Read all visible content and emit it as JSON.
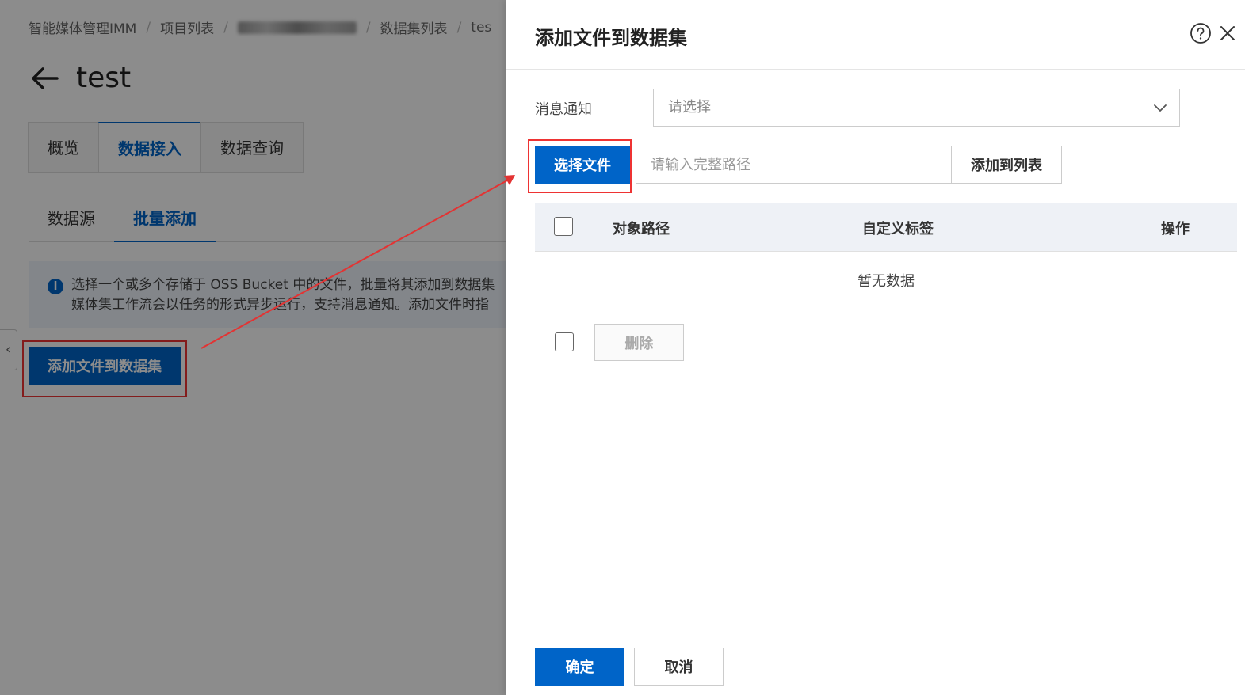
{
  "breadcrumb": {
    "items": [
      "智能媒体管理IMM",
      "项目列表",
      "数据集列表",
      "tes"
    ],
    "separator": "/"
  },
  "page": {
    "title": "test",
    "tabs": [
      "概览",
      "数据接入",
      "数据查询"
    ],
    "active_tab": "数据接入",
    "subtabs": [
      "数据源",
      "批量添加"
    ],
    "active_subtab": "批量添加",
    "notice_line1": "选择一个或多个存储于 OSS Bucket 中的文件，批量将其添加到数据集",
    "notice_line2": "媒体集工作流会以任务的形式异步运行，支持消息通知。添加文件时指",
    "add_button": "添加文件到数据集",
    "collapse_icon": "chevron-left-icon"
  },
  "drawer": {
    "title": "添加文件到数据集",
    "notify_label": "消息通知",
    "notify_placeholder": "请选择",
    "select_file_button": "选择文件",
    "path_placeholder": "请输入完整路径",
    "add_to_list_button": "添加到列表",
    "table_headers": [
      "对象路径",
      "自定义标签",
      "操作"
    ],
    "empty_text": "暂无数据",
    "delete_button": "删除",
    "ok_button": "确定",
    "cancel_button": "取消"
  },
  "colors": {
    "primary": "#0064c8",
    "highlight": "#e33333",
    "overlay": "rgba(0,0,0,0.45)"
  }
}
